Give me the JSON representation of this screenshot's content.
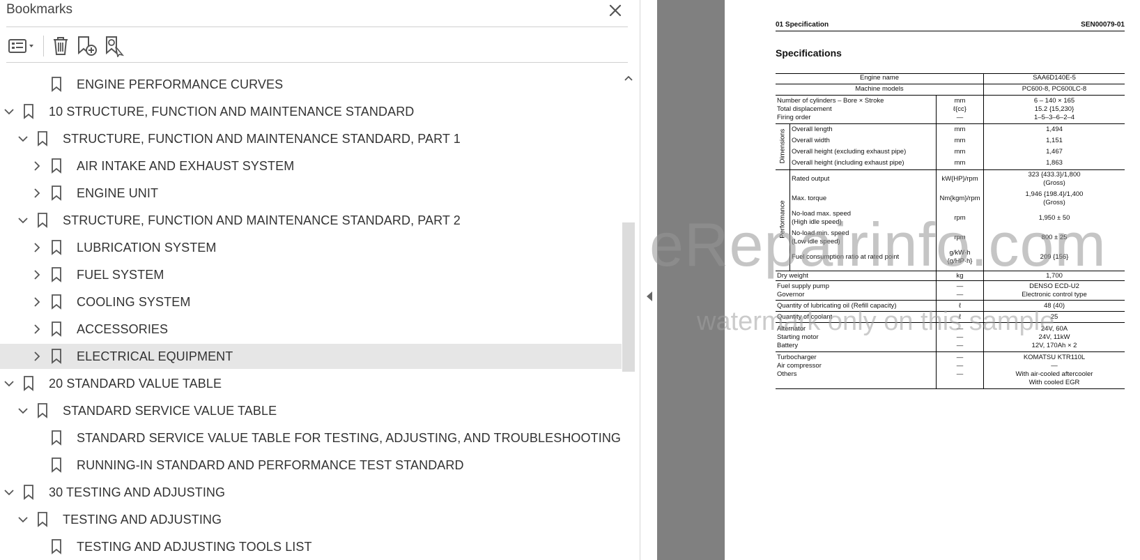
{
  "panel": {
    "title": "Bookmarks"
  },
  "toolbar": {
    "options_icon": "list-options-icon",
    "delete_icon": "trash-icon",
    "add_icon": "add-bookmark-icon",
    "find_icon": "find-bookmark-icon"
  },
  "bookmarks": [
    {
      "label": "ENGINE PERFORMANCE CURVES",
      "level": 2,
      "chevron": "none"
    },
    {
      "label": "10 STRUCTURE, FUNCTION AND MAINTENANCE STANDARD",
      "level": 0,
      "chevron": "down"
    },
    {
      "label": "STRUCTURE, FUNCTION AND MAINTENANCE STANDARD, PART 1",
      "level": 1,
      "chevron": "down"
    },
    {
      "label": "AIR INTAKE AND EXHAUST SYSTEM",
      "level": 2,
      "chevron": "right"
    },
    {
      "label": "ENGINE UNIT",
      "level": 2,
      "chevron": "right"
    },
    {
      "label": "STRUCTURE, FUNCTION AND MAINTENANCE STANDARD, PART 2",
      "level": 1,
      "chevron": "down"
    },
    {
      "label": "LUBRICATION SYSTEM",
      "level": 2,
      "chevron": "right"
    },
    {
      "label": "FUEL SYSTEM",
      "level": 2,
      "chevron": "right"
    },
    {
      "label": "COOLING SYSTEM",
      "level": 2,
      "chevron": "right"
    },
    {
      "label": "ACCESSORIES",
      "level": 2,
      "chevron": "right"
    },
    {
      "label": "ELECTRICAL EQUIPMENT",
      "level": 2,
      "chevron": "right",
      "selected": true
    },
    {
      "label": "20 STANDARD VALUE TABLE",
      "level": 0,
      "chevron": "down"
    },
    {
      "label": "STANDARD SERVICE VALUE TABLE",
      "level": 1,
      "chevron": "down"
    },
    {
      "label": "STANDARD SERVICE VALUE TABLE FOR TESTING, ADJUSTING, AND TROUBLESHOOTING",
      "level": 2,
      "chevron": "none"
    },
    {
      "label": "RUNNING-IN STANDARD AND PERFORMANCE TEST STANDARD",
      "level": 2,
      "chevron": "none"
    },
    {
      "label": "30 TESTING AND ADJUSTING",
      "level": 0,
      "chevron": "down"
    },
    {
      "label": "TESTING AND ADJUSTING",
      "level": 1,
      "chevron": "down"
    },
    {
      "label": "TESTING AND ADJUSTING TOOLS LIST",
      "level": 2,
      "chevron": "none"
    }
  ],
  "document": {
    "header_left": "01 Specification",
    "header_right": "SEN00079-01",
    "heading": "Specifications",
    "engine_name_label": "Engine name",
    "engine_name_value": "SAA6D140E-5",
    "machine_models_label": "Machine models",
    "machine_models_value": "PC600-8, PC600LC-8",
    "rows": {
      "cyl_label": "Number of cylinders – Bore × Stroke",
      "cyl_unit": "mm",
      "cyl_value": "6 – 140 × 165",
      "disp_label": "Total displacement",
      "disp_unit": "ℓ{cc}",
      "disp_value": "15.2 {15,230}",
      "firing_label": "Firing order",
      "firing_unit": "—",
      "firing_value": "1–5–3–6–2–4",
      "dimensions_group": "Dimensions",
      "len_label": "Overall length",
      "len_unit": "mm",
      "len_value": "1,494",
      "wid_label": "Overall width",
      "wid_unit": "mm",
      "wid_value": "1,151",
      "hx_label": "Overall height (excluding exhaust pipe)",
      "hx_unit": "mm",
      "hx_value": "1,467",
      "hi_label": "Overall height (including exhaust pipe)",
      "hi_unit": "mm",
      "hi_value": "1,863",
      "performance_group": "Performance",
      "ro_label": "Rated output",
      "ro_unit": "kW{HP}/rpm",
      "ro_value": "323 {433.3}/1,800",
      "ro_value2": "(Gross)",
      "mt_label": "Max. torque",
      "mt_unit": "Nm{kgm}/rpm",
      "mt_value": "1,946 {198.4}/1,400",
      "mt_value2": "(Gross)",
      "nh_label": "No-load max. speed",
      "nh_label2": "(High idle speed)",
      "nh_unit": "rpm",
      "nh_value": "1,950 ± 50",
      "nl_label": "No-load min. speed",
      "nl_label2": "(Low idle speed)",
      "nl_unit": "rpm",
      "nl_value": "800 ± 25",
      "fc_label": "Fuel consumption ratio at rated point",
      "fc_unit": "g/kW·h",
      "fc_unit2": "{g/HP·h}",
      "fc_value": "209 {156}",
      "dw_label": "Dry weight",
      "dw_unit": "kg",
      "dw_value": "1,700",
      "fp_label": "Fuel supply pump",
      "fp_unit": "—",
      "fp_value": "DENSO ECD-U2",
      "gv_label": "Governor",
      "gv_unit": "—",
      "gv_value": "Electronic control type",
      "lo_label": "Quantity of lubricating oil (Refill capacity)",
      "lo_unit": "ℓ",
      "lo_value": "48 (40)",
      "cl_label": "Quantity of coolant",
      "cl_unit": "ℓ",
      "cl_value": "25",
      "alt_label": "Alternator",
      "alt_unit": "—",
      "alt_value": "24V, 60A",
      "sm_label": "Starting motor",
      "sm_unit": "—",
      "sm_value": "24V, 11kW",
      "bat_label": "Battery",
      "bat_unit": "—",
      "bat_value": "12V, 170Ah × 2",
      "tc_label": "Turbocharger",
      "tc_unit": "—",
      "tc_value": "KOMATSU KTR110L",
      "ac_label": "Air compressor",
      "ac_unit": "—",
      "ac_value": "—",
      "ot_label": "Others",
      "ot_unit": "—",
      "ot_value": "With air-cooled aftercooler",
      "ot_value2": "With cooled EGR"
    }
  },
  "watermark": {
    "line1": "eRepairinfo.com",
    "line2": "watermark only on this sample"
  }
}
